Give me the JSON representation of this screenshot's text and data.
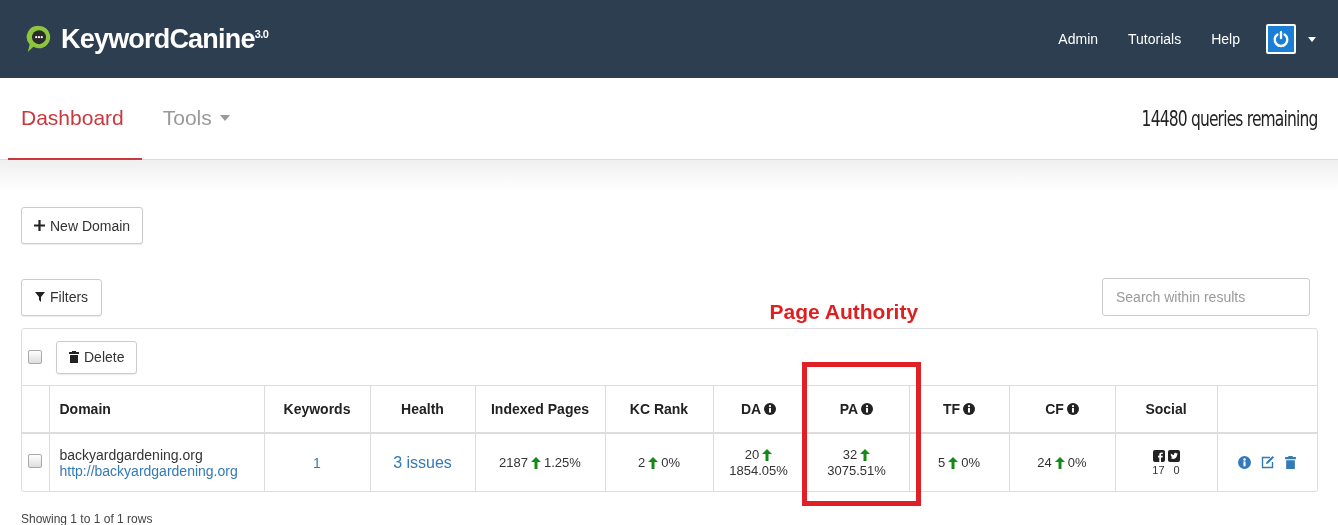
{
  "brand": {
    "name": "KeywordCanine",
    "version": "3.0"
  },
  "top_nav": [
    {
      "label": "Admin"
    },
    {
      "label": "Tutorials"
    },
    {
      "label": "Help"
    }
  ],
  "tabs": [
    {
      "label": "Dashboard",
      "selected": true,
      "dropdown": false
    },
    {
      "label": "Tools",
      "selected": false,
      "dropdown": true
    }
  ],
  "queries_remaining": "14480 queries remaining",
  "new_domain_button": "New Domain",
  "filters_button": "Filters",
  "search": {
    "placeholder": "Search within results"
  },
  "delete_button": "Delete",
  "select_all": {
    "checked": false
  },
  "columns": [
    {
      "label": "Domain",
      "info": false
    },
    {
      "label": "Keywords",
      "info": false
    },
    {
      "label": "Health",
      "info": false
    },
    {
      "label": "Indexed Pages",
      "info": false
    },
    {
      "label": "KC Rank",
      "info": false
    },
    {
      "label": "DA",
      "info": true
    },
    {
      "label": "PA",
      "info": true,
      "annotation": "Page Authority"
    },
    {
      "label": "TF",
      "info": true
    },
    {
      "label": "CF",
      "info": true
    },
    {
      "label": "Social",
      "info": false
    }
  ],
  "rows": [
    {
      "checked": false,
      "domain": "backyardgardening.org",
      "url": "http://backyardgardening.org",
      "keywords": "1",
      "health": "3 issues",
      "metrics": [
        {
          "kind": "inline",
          "value": "2187",
          "change": "1.25%"
        },
        {
          "kind": "inline",
          "value": "2",
          "change": "0%"
        },
        {
          "kind": "stacked",
          "value": "20",
          "change": "1854.05%"
        },
        {
          "kind": "stacked",
          "value": "32",
          "change": "3075.51%"
        },
        {
          "kind": "inline",
          "value": "5",
          "change": "0%"
        },
        {
          "kind": "inline",
          "value": "24",
          "change": "0%"
        }
      ],
      "social": {
        "facebook": "17",
        "twitter": "0"
      }
    }
  ],
  "footer": "Showing 1 to 1 of 1 rows"
}
